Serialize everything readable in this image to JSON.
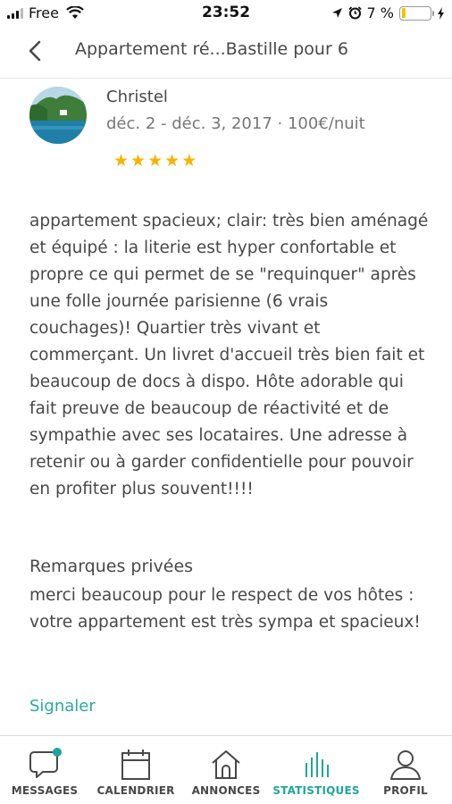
{
  "status_bar": {
    "carrier": "Free",
    "time": "23:52",
    "battery_percent": "7 %",
    "battery_level": 0.07
  },
  "header": {
    "title": "Appartement ré...Bastille pour 6"
  },
  "review": {
    "reviewer_name": "Christel",
    "stay_meta": "déc. 2 - déc. 3, 2017 · 100€/nuit",
    "rating": 5,
    "text": "appartement spacieux; clair: très bien aménagé et équipé : la literie est hyper confortable et propre ce qui permet de se \"requinquer\" après une folle journée parisienne (6 vrais couchages)! Quartier très vivant et commerçant. Un livret d'accueil très bien fait et beaucoup de docs à dispo. Hôte adorable qui fait preuve de beaucoup de réactivité et de sympathie avec ses locataires. Une adresse à retenir ou à garder confidentielle pour pouvoir en profiter plus souvent!!!!"
  },
  "private_remarks": {
    "title": "Remarques privées",
    "text": "merci beaucoup pour le respect de vos hôtes : votre appartement est très sympa et spacieux!"
  },
  "report_label": "Signaler",
  "tabs": [
    {
      "label": "MESSAGES",
      "icon": "chat-bubble-icon",
      "badge": true
    },
    {
      "label": "CALENDRIER",
      "icon": "calendar-icon"
    },
    {
      "label": "ANNONCES",
      "icon": "house-icon"
    },
    {
      "label": "STATISTIQUES",
      "icon": "bar-chart-icon",
      "active": true
    },
    {
      "label": "PROFIL",
      "icon": "person-icon"
    }
  ],
  "colors": {
    "accent": "#1fa69b",
    "star": "#f5b400",
    "text": "#484848"
  }
}
